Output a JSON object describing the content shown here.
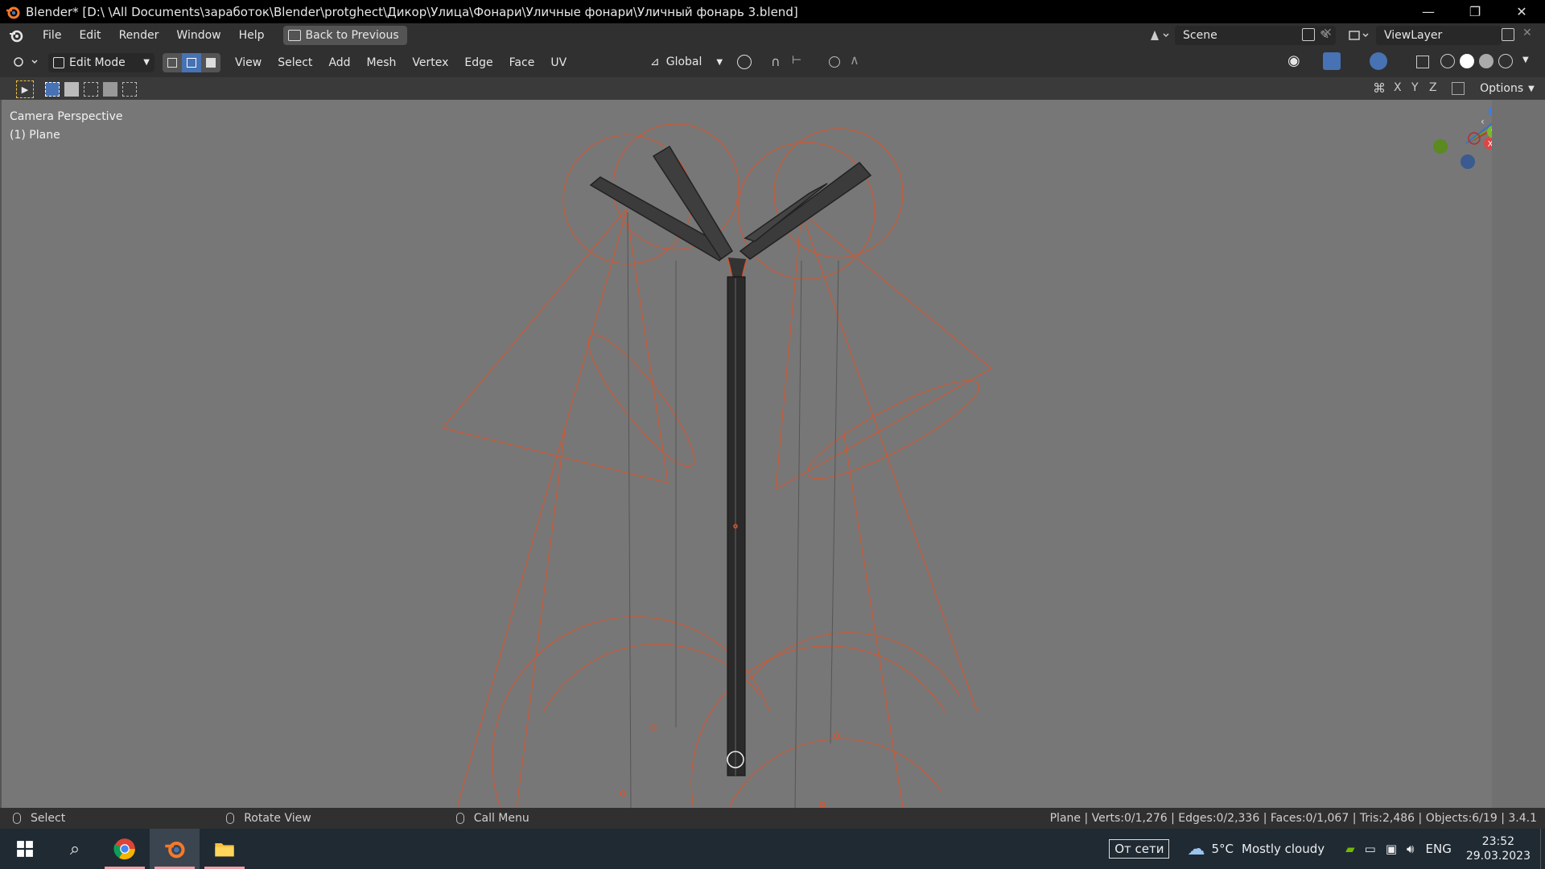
{
  "window": {
    "title": "Blender* [D:\\ \\All Documents\\заработок\\Blender\\protghect\\Дикор\\Улица\\Фонари\\Уличные фонари\\Уличный фонарь 3.blend]",
    "minimize": "—",
    "restore": "❐",
    "close": "✕"
  },
  "topbar": {
    "menus": [
      "File",
      "Edit",
      "Render",
      "Window",
      "Help"
    ],
    "back_button": "Back to Previous",
    "scene": "Scene",
    "view_layer": "ViewLayer"
  },
  "header": {
    "mode": "Edit Mode",
    "menus": [
      "View",
      "Select",
      "Add",
      "Mesh",
      "Vertex",
      "Edge",
      "Face",
      "UV"
    ],
    "transform_orientation": "Global",
    "select_mode_active": "edge"
  },
  "toolheader": {
    "axes": [
      "X",
      "Y",
      "Z"
    ],
    "options": "Options"
  },
  "viewport": {
    "view_name": "Camera Perspective",
    "object_name": "(1) Plane",
    "background": "#777777",
    "wire_color": "#d9542b",
    "gizmo": {
      "z": "Z",
      "y": "Y",
      "x": "X"
    }
  },
  "statusbar": {
    "select": "Select",
    "rotate": "Rotate View",
    "call_menu": "Call Menu",
    "stats": "Plane | Verts:0/1,276 | Edges:0/2,336 | Faces:0/1,067 | Tris:2,486 | Objects:6/19 | 3.4.1"
  },
  "taskbar": {
    "network": "От сети",
    "temperature": "5°C",
    "weather": "Mostly cloudy",
    "language": "ENG",
    "time": "23:52",
    "date": "29.03.2023"
  }
}
